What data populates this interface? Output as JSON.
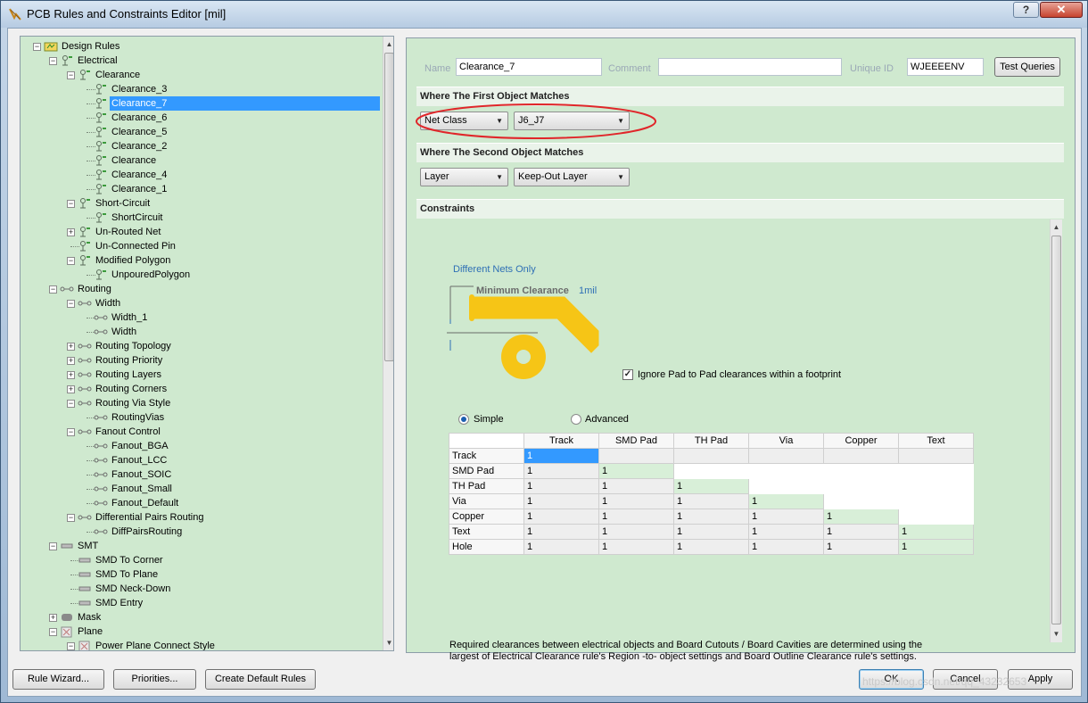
{
  "window": {
    "title": "PCB Rules and Constraints Editor [mil]",
    "help_label": "?",
    "close_label": "✕"
  },
  "tree": {
    "rows": [
      {
        "label": "Design Rules",
        "level": 0,
        "exp": "−",
        "icon": "design-rules-icon"
      },
      {
        "label": "Electrical",
        "level": 1,
        "exp": "−",
        "icon": "electrical-icon"
      },
      {
        "label": "Clearance",
        "level": 2,
        "exp": "−",
        "icon": "clearance-icon"
      },
      {
        "label": "Clearance_3",
        "level": 3,
        "exp": "",
        "icon": "clearance-rule-icon"
      },
      {
        "label": "Clearance_7",
        "level": 3,
        "exp": "",
        "icon": "clearance-rule-icon",
        "selected": true
      },
      {
        "label": "Clearance_6",
        "level": 3,
        "exp": "",
        "icon": "clearance-rule-icon"
      },
      {
        "label": "Clearance_5",
        "level": 3,
        "exp": "",
        "icon": "clearance-rule-icon"
      },
      {
        "label": "Clearance_2",
        "level": 3,
        "exp": "",
        "icon": "clearance-rule-icon"
      },
      {
        "label": "Clearance",
        "level": 3,
        "exp": "",
        "icon": "clearance-rule-icon"
      },
      {
        "label": "Clearance_4",
        "level": 3,
        "exp": "",
        "icon": "clearance-rule-icon"
      },
      {
        "label": "Clearance_1",
        "level": 3,
        "exp": "",
        "icon": "clearance-rule-icon"
      },
      {
        "label": "Short-Circuit",
        "level": 2,
        "exp": "−",
        "icon": "clearance-icon"
      },
      {
        "label": "ShortCircuit",
        "level": 3,
        "exp": "",
        "icon": "clearance-rule-icon"
      },
      {
        "label": "Un-Routed Net",
        "level": 2,
        "exp": "+",
        "icon": "clearance-icon"
      },
      {
        "label": "Un-Connected Pin",
        "level": 2,
        "exp": "",
        "icon": "clearance-icon"
      },
      {
        "label": "Modified Polygon",
        "level": 2,
        "exp": "−",
        "icon": "clearance-icon"
      },
      {
        "label": "UnpouredPolygon",
        "level": 3,
        "exp": "",
        "icon": "clearance-rule-icon"
      },
      {
        "label": "Routing",
        "level": 1,
        "exp": "−",
        "icon": "routing-icon"
      },
      {
        "label": "Width",
        "level": 2,
        "exp": "−",
        "icon": "routing-icon"
      },
      {
        "label": "Width_1",
        "level": 3,
        "exp": "",
        "icon": "routing-rule-icon"
      },
      {
        "label": "Width",
        "level": 3,
        "exp": "",
        "icon": "routing-rule-icon"
      },
      {
        "label": "Routing Topology",
        "level": 2,
        "exp": "+",
        "icon": "routing-icon"
      },
      {
        "label": "Routing Priority",
        "level": 2,
        "exp": "+",
        "icon": "routing-icon"
      },
      {
        "label": "Routing Layers",
        "level": 2,
        "exp": "+",
        "icon": "routing-icon"
      },
      {
        "label": "Routing Corners",
        "level": 2,
        "exp": "+",
        "icon": "routing-icon"
      },
      {
        "label": "Routing Via Style",
        "level": 2,
        "exp": "−",
        "icon": "routing-icon"
      },
      {
        "label": "RoutingVias",
        "level": 3,
        "exp": "",
        "icon": "routing-rule-icon"
      },
      {
        "label": "Fanout Control",
        "level": 2,
        "exp": "−",
        "icon": "routing-icon"
      },
      {
        "label": "Fanout_BGA",
        "level": 3,
        "exp": "",
        "icon": "routing-rule-icon"
      },
      {
        "label": "Fanout_LCC",
        "level": 3,
        "exp": "",
        "icon": "routing-rule-icon"
      },
      {
        "label": "Fanout_SOIC",
        "level": 3,
        "exp": "",
        "icon": "routing-rule-icon"
      },
      {
        "label": "Fanout_Small",
        "level": 3,
        "exp": "",
        "icon": "routing-rule-icon"
      },
      {
        "label": "Fanout_Default",
        "level": 3,
        "exp": "",
        "icon": "routing-rule-icon"
      },
      {
        "label": "Differential Pairs Routing",
        "level": 2,
        "exp": "−",
        "icon": "routing-icon"
      },
      {
        "label": "DiffPairsRouting",
        "level": 3,
        "exp": "",
        "icon": "routing-rule-icon"
      },
      {
        "label": "SMT",
        "level": 1,
        "exp": "−",
        "icon": "smt-icon"
      },
      {
        "label": "SMD To Corner",
        "level": 2,
        "exp": "",
        "icon": "smt-icon"
      },
      {
        "label": "SMD To Plane",
        "level": 2,
        "exp": "",
        "icon": "smt-icon"
      },
      {
        "label": "SMD Neck-Down",
        "level": 2,
        "exp": "",
        "icon": "smt-icon"
      },
      {
        "label": "SMD Entry",
        "level": 2,
        "exp": "",
        "icon": "smt-icon"
      },
      {
        "label": "Mask",
        "level": 1,
        "exp": "+",
        "icon": "mask-icon"
      },
      {
        "label": "Plane",
        "level": 1,
        "exp": "−",
        "icon": "plane-icon"
      },
      {
        "label": "Power Plane Connect Style",
        "level": 2,
        "exp": "−",
        "icon": "plane-icon"
      }
    ]
  },
  "rule": {
    "name_label": "Name",
    "name_value": "Clearance_7",
    "comment_label": "Comment",
    "comment_value": "",
    "uid_label": "Unique ID",
    "uid_value": "WJEEEENV",
    "test_queries": "Test Queries"
  },
  "first_match": {
    "heading": "Where The First Object Matches",
    "type": "Net Class",
    "value": "J6_J7"
  },
  "second_match": {
    "heading": "Where The Second Object Matches",
    "type": "Layer",
    "value": "Keep-Out Layer"
  },
  "constraints": {
    "heading": "Constraints",
    "nets_scope": "Different Nets Only",
    "min_clearance_label": "Minimum Clearance",
    "min_clearance_value": "1mil",
    "ignore_pad_label": "Ignore Pad to Pad clearances within a footprint",
    "ignore_pad_checked": true,
    "mode_simple": "Simple",
    "mode_advanced": "Advanced",
    "mode_selected": "Simple",
    "columns": [
      "Track",
      "SMD Pad",
      "TH Pad",
      "Via",
      "Copper",
      "Text"
    ],
    "rows": [
      {
        "name": "Track",
        "values": [
          "1"
        ]
      },
      {
        "name": "SMD Pad",
        "values": [
          "1",
          "1"
        ]
      },
      {
        "name": "TH Pad",
        "values": [
          "1",
          "1",
          "1"
        ]
      },
      {
        "name": "Via",
        "values": [
          "1",
          "1",
          "1",
          "1"
        ]
      },
      {
        "name": "Copper",
        "values": [
          "1",
          "1",
          "1",
          "1",
          "1"
        ]
      },
      {
        "name": "Text",
        "values": [
          "1",
          "1",
          "1",
          "1",
          "1",
          "1"
        ]
      },
      {
        "name": "Hole",
        "values": [
          "1",
          "1",
          "1",
          "1",
          "1",
          "1"
        ]
      }
    ],
    "note_line1": "Required clearances between electrical objects and Board Cutouts / Board Cavities are determined using the",
    "note_line2": "largest of Electrical Clearance rule's Region -to- object settings and Board Outline Clearance rule's settings."
  },
  "buttons": {
    "rule_wizard": "Rule Wizard...",
    "priorities": "Priorities...",
    "create_default": "Create Default Rules",
    "ok": "OK",
    "cancel": "Cancel",
    "apply": "Apply"
  },
  "watermark": "https://blog.csdn.net/qq_43232653",
  "colors": {
    "tree_bg": "#cfe9cf",
    "panel_bg": "#cfe9cf",
    "selection": "#3399ff",
    "highlight_oval": "#e0262a",
    "pad_fill": "#f6c516"
  }
}
